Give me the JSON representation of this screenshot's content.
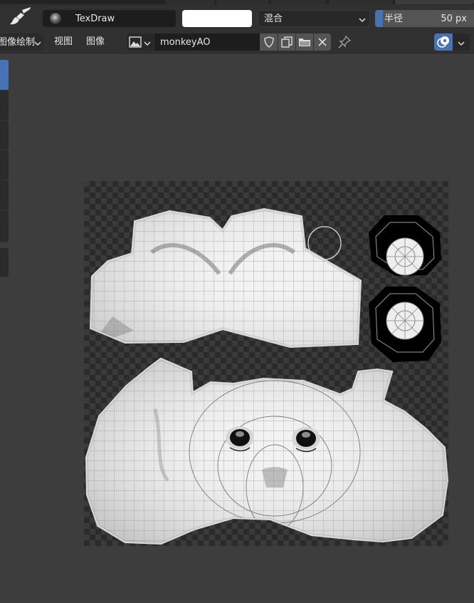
{
  "header": {
    "brush_name": "TexDraw",
    "blend_mode": "混合",
    "radius_label": "半径",
    "radius_value": "50 px",
    "radius_fraction": 0.05
  },
  "menubar": {
    "mode_label": "图像绘制",
    "view_label": "视图",
    "image_label": "图像",
    "image_name": "monkeyAO"
  },
  "icons": {
    "tool": "paintbrush-icon",
    "brush_preview": "brush-preview-icon",
    "image_type": "image-icon",
    "fake_user": "shield-icon",
    "duplicate": "duplicate-icon",
    "open": "folder-icon",
    "unlink": "close-icon",
    "pin": "pin-icon",
    "overlay": "overlay-icon"
  },
  "colors": {
    "brush_color": "#ffffff",
    "accent": "#4772b3",
    "background": "#3d3d3d",
    "header": "#303030"
  }
}
